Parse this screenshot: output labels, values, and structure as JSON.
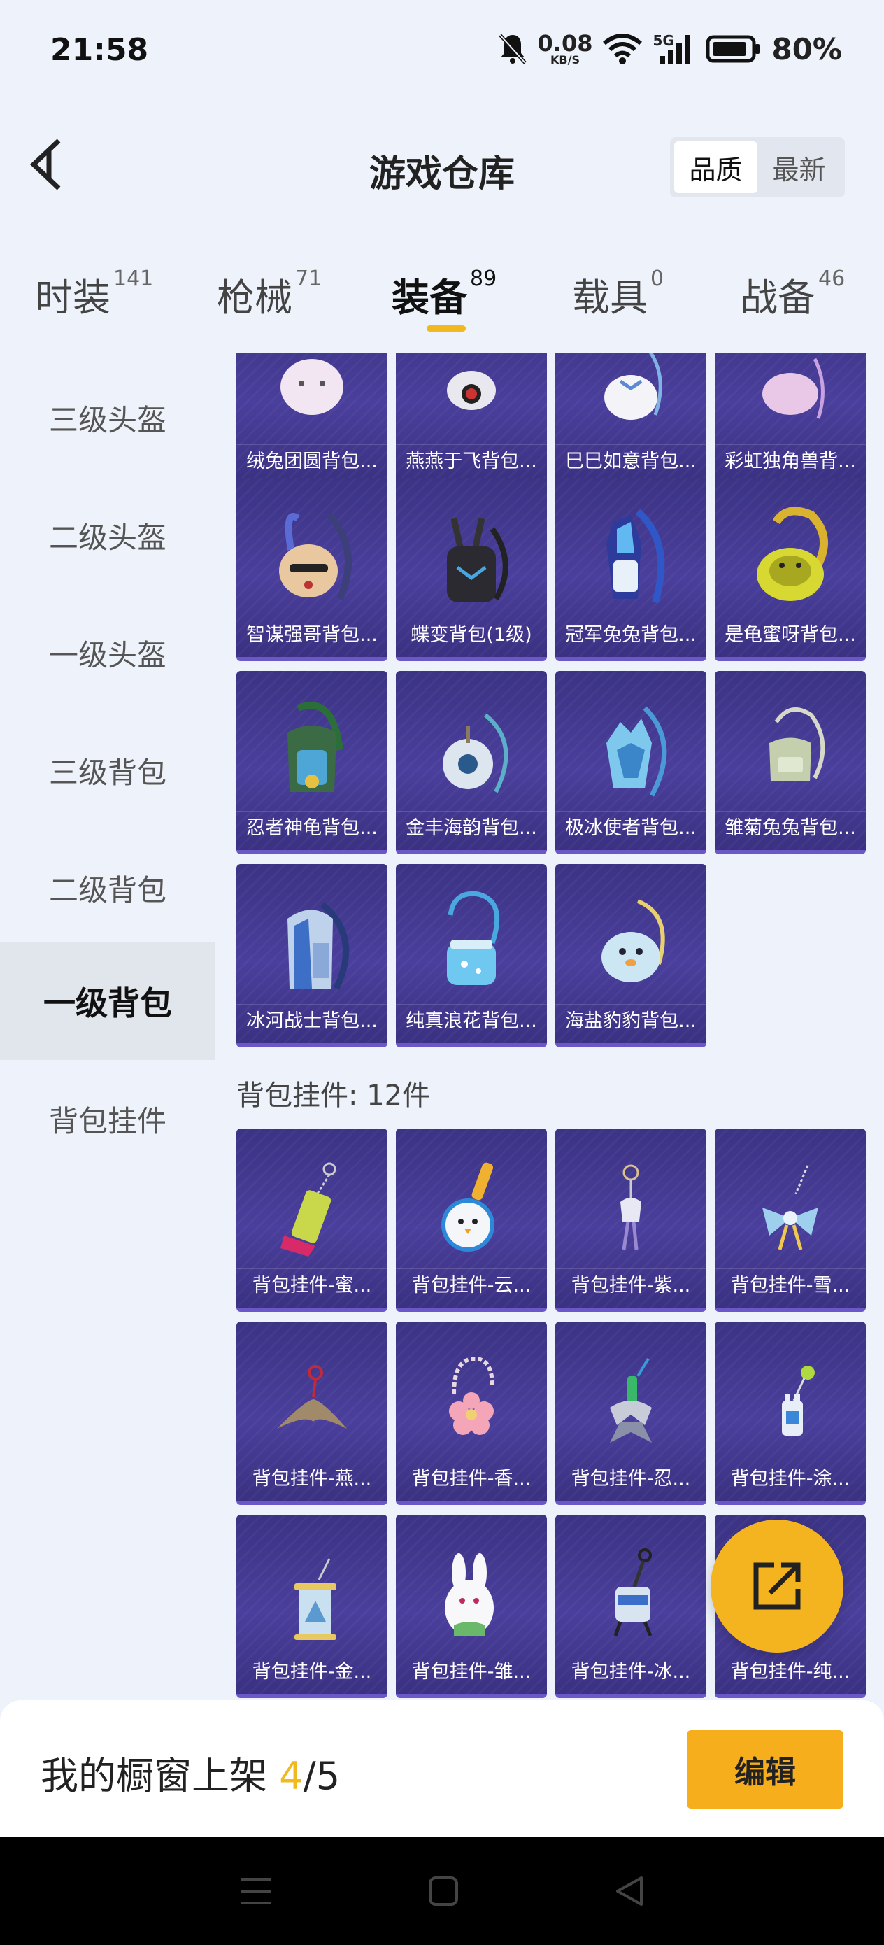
{
  "status_bar": {
    "time": "21:58",
    "net_speed_value": "0.08",
    "net_speed_unit": "KB/S",
    "network_type": "5G",
    "battery": "80%",
    "icons": [
      "bell-muted-icon",
      "wifi-icon",
      "signal-icon",
      "battery-icon"
    ]
  },
  "header": {
    "title": "游戏仓库",
    "sort_options": [
      {
        "label": "品质",
        "active": true
      },
      {
        "label": "最新",
        "active": false
      }
    ]
  },
  "tabs": [
    {
      "label": "时装",
      "count": "141",
      "active": false
    },
    {
      "label": "枪械",
      "count": "71",
      "active": false
    },
    {
      "label": "装备",
      "count": "89",
      "active": true
    },
    {
      "label": "载具",
      "count": "0",
      "active": false
    },
    {
      "label": "战备",
      "count": "46",
      "active": false
    }
  ],
  "sidebar": {
    "items": [
      {
        "label": "三级头盔",
        "active": false
      },
      {
        "label": "二级头盔",
        "active": false
      },
      {
        "label": "一级头盔",
        "active": false
      },
      {
        "label": "三级背包",
        "active": false
      },
      {
        "label": "二级背包",
        "active": false
      },
      {
        "label": "一级背包",
        "active": true
      },
      {
        "label": "背包挂件",
        "active": false
      }
    ]
  },
  "backpacks": [
    {
      "name": "绒兔团圆背包..."
    },
    {
      "name": "燕燕于飞背包..."
    },
    {
      "name": "巳巳如意背包..."
    },
    {
      "name": "彩虹独角兽背..."
    },
    {
      "name": "智谋强哥背包..."
    },
    {
      "name": "蝶变背包(1级)"
    },
    {
      "name": "冠军兔兔背包..."
    },
    {
      "name": "是龟蜜呀背包..."
    },
    {
      "name": "忍者神龟背包..."
    },
    {
      "name": "金丰海韵背包..."
    },
    {
      "name": "极冰使者背包..."
    },
    {
      "name": "雏菊兔兔背包..."
    },
    {
      "name": "冰河战士背包..."
    },
    {
      "name": "纯真浪花背包..."
    },
    {
      "name": "海盐豹豹背包..."
    }
  ],
  "pendant_section": {
    "label": "背包挂件: 12件"
  },
  "pendants": [
    {
      "name": "背包挂件-蜜..."
    },
    {
      "name": "背包挂件-云..."
    },
    {
      "name": "背包挂件-紫..."
    },
    {
      "name": "背包挂件-雪..."
    },
    {
      "name": "背包挂件-燕..."
    },
    {
      "name": "背包挂件-香..."
    },
    {
      "name": "背包挂件-忍..."
    },
    {
      "name": "背包挂件-涂..."
    },
    {
      "name": "背包挂件-金..."
    },
    {
      "name": "背包挂件-雏..."
    },
    {
      "name": "背包挂件-冰..."
    },
    {
      "name": "背包挂件-纯..."
    }
  ],
  "bottom_bar": {
    "shelf_label": "我的橱窗上架 ",
    "shelf_count": "4",
    "shelf_total": "/5",
    "edit_label": "编辑"
  },
  "colors": {
    "accent": "#f2b81f",
    "card_bg": "#3f378b",
    "card_border": "#6c57c9"
  }
}
